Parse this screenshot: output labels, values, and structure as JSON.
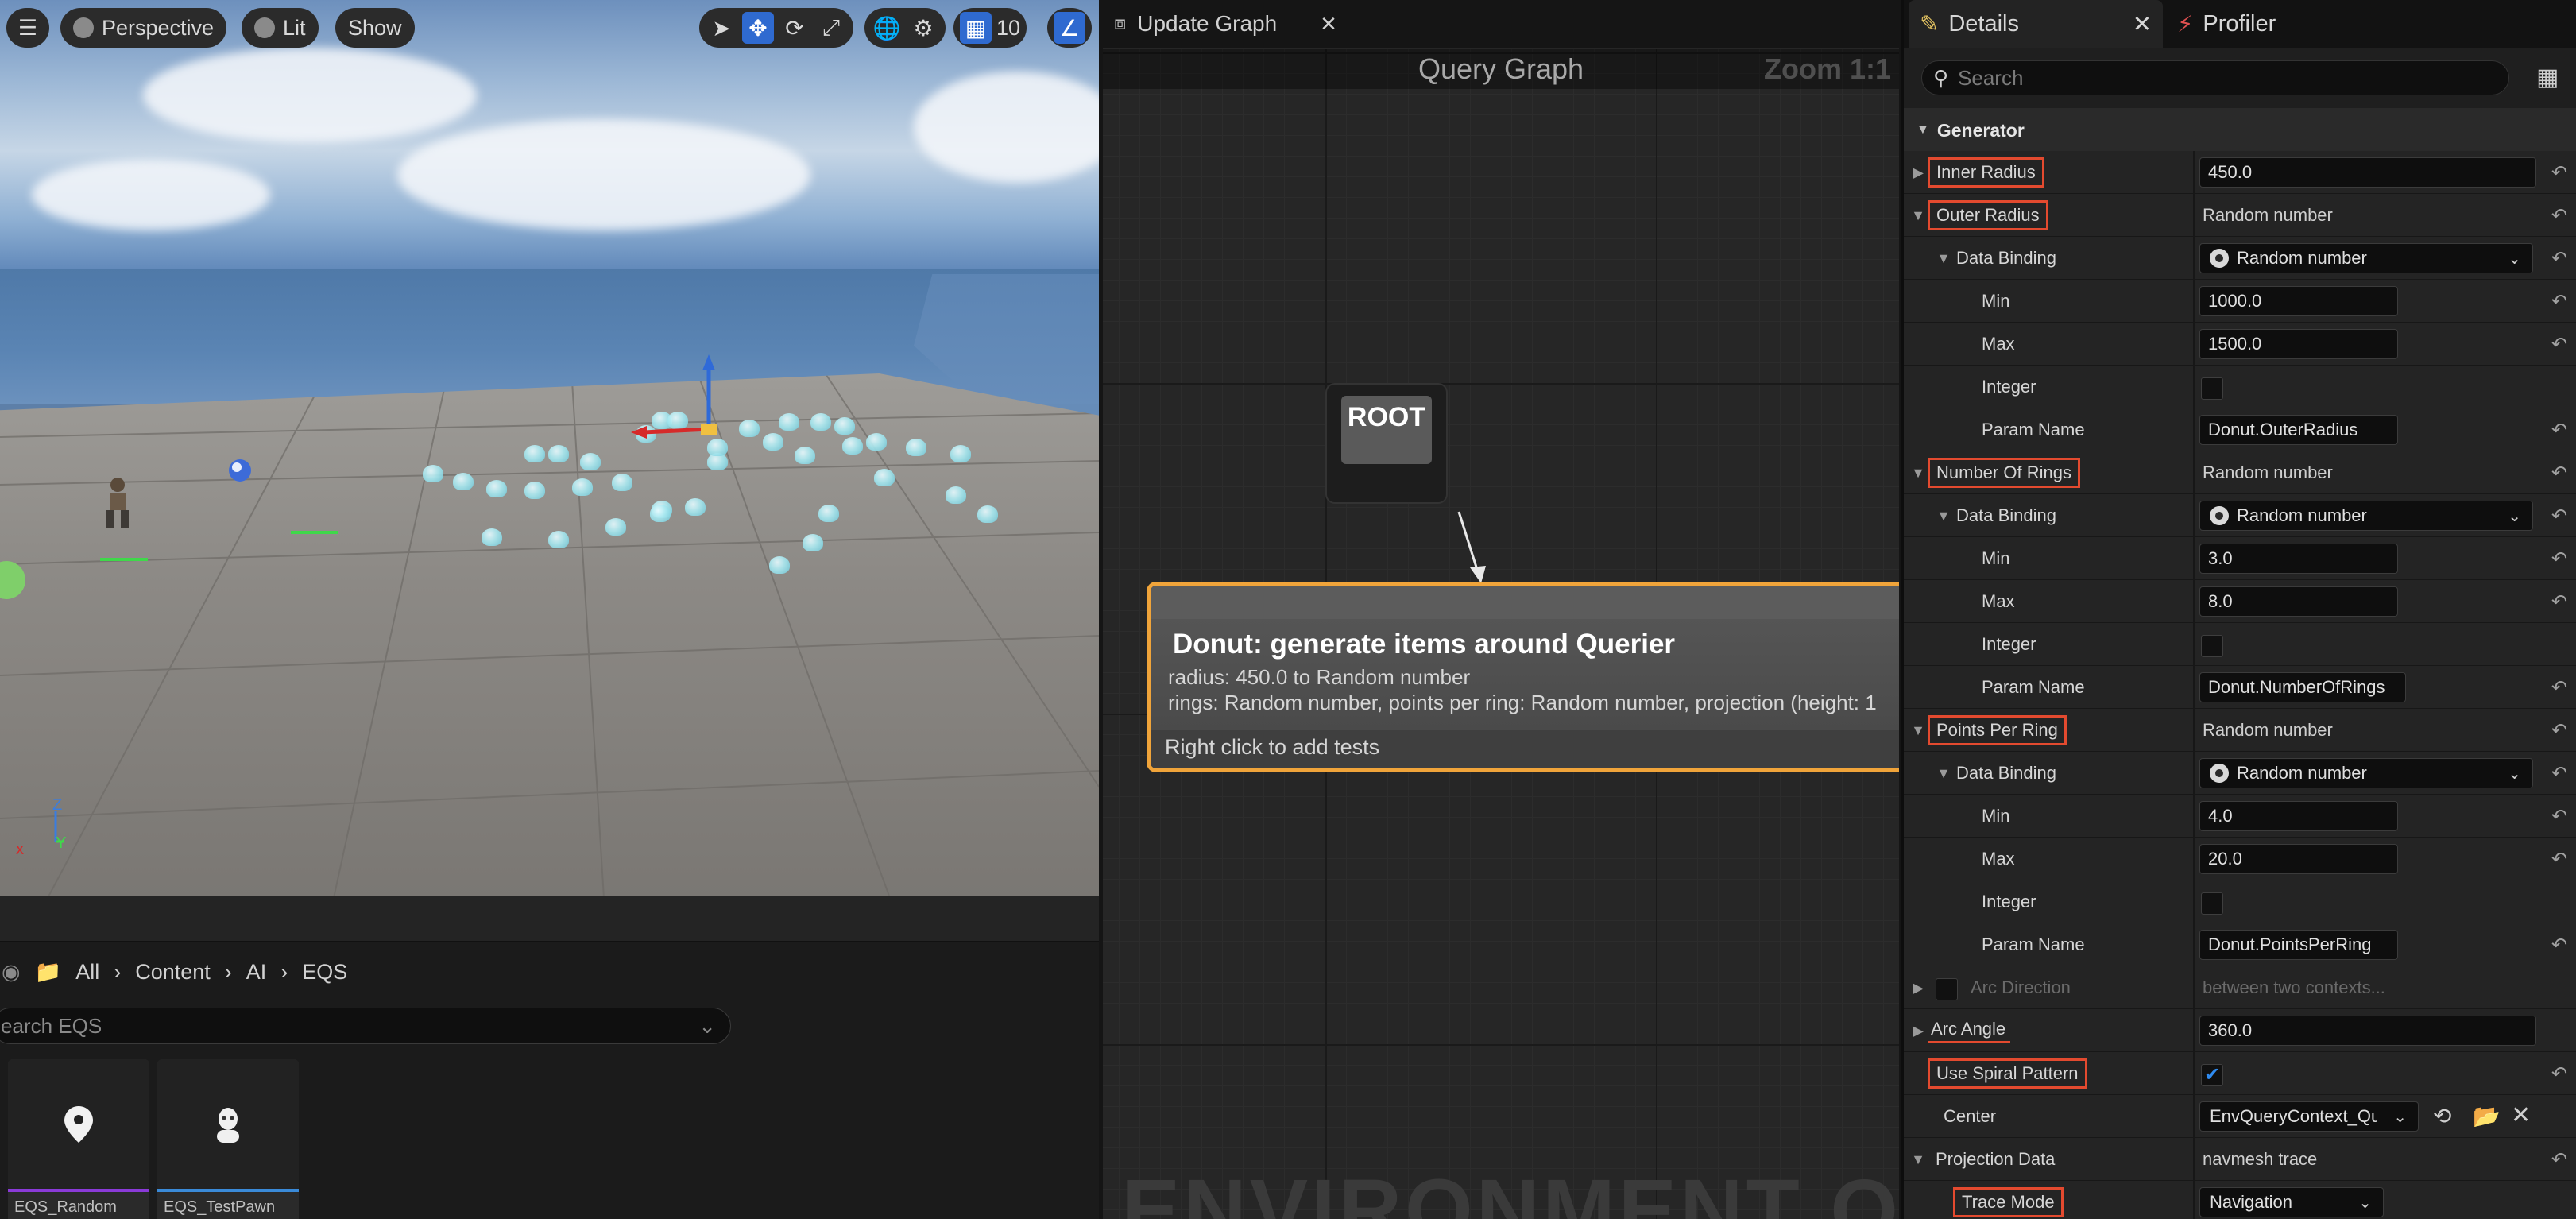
{
  "viewport": {
    "perspective_label": "Perspective",
    "lit_label": "Lit",
    "show_label": "Show",
    "grid_snap_value": "10"
  },
  "content_browser": {
    "breadcrumb": [
      "All",
      "Content",
      "AI",
      "EQS"
    ],
    "search_placeholder": "earch EQS",
    "assets": [
      {
        "name": "EQS_Random",
        "bar_color": "#8a3ad8"
      },
      {
        "name": "EQS_TestPawn",
        "bar_color": "#3a8ad8"
      }
    ]
  },
  "graph": {
    "tab_label": "Update Graph",
    "title": "Query Graph",
    "zoom": "Zoom 1:1",
    "root_label": "ROOT",
    "donut_title": "Donut: generate items around Querier",
    "donut_line1": "radius: 450.0 to Random number",
    "donut_line2": "rings: Random number, points per ring: Random number, projection (height: 1",
    "donut_hint": "Right click to add tests",
    "watermark": "ENVIRONMENT QU"
  },
  "details": {
    "tab_details": "Details",
    "tab_profiler": "Profiler",
    "search_placeholder": "Search",
    "section": "Generator",
    "rows": {
      "inner_radius": {
        "label": "Inner Radius",
        "value": "450.0"
      },
      "outer_radius": {
        "label": "Outer Radius",
        "value": "Random number"
      },
      "outer_binding": {
        "label": "Data Binding",
        "value": "Random number"
      },
      "outer_min": {
        "label": "Min",
        "value": "1000.0"
      },
      "outer_max": {
        "label": "Max",
        "value": "1500.0"
      },
      "outer_integer": {
        "label": "Integer"
      },
      "outer_param": {
        "label": "Param Name",
        "value": "Donut.OuterRadius"
      },
      "rings": {
        "label": "Number Of Rings",
        "value": "Random number"
      },
      "rings_binding": {
        "label": "Data Binding",
        "value": "Random number"
      },
      "rings_min": {
        "label": "Min",
        "value": "3.0"
      },
      "rings_max": {
        "label": "Max",
        "value": "8.0"
      },
      "rings_integer": {
        "label": "Integer"
      },
      "rings_param": {
        "label": "Param Name",
        "value": "Donut.NumberOfRings"
      },
      "ppr": {
        "label": "Points Per Ring",
        "value": "Random number"
      },
      "ppr_binding": {
        "label": "Data Binding",
        "value": "Random number"
      },
      "ppr_min": {
        "label": "Min",
        "value": "4.0"
      },
      "ppr_max": {
        "label": "Max",
        "value": "20.0"
      },
      "ppr_integer": {
        "label": "Integer"
      },
      "ppr_param": {
        "label": "Param Name",
        "value": "Donut.PointsPerRing"
      },
      "arc_direction": {
        "label": "Arc Direction",
        "value": "between two contexts..."
      },
      "arc_angle": {
        "label": "Arc Angle",
        "value": "360.0"
      },
      "spiral": {
        "label": "Use Spiral Pattern",
        "checked": true
      },
      "center": {
        "label": "Center",
        "value": "EnvQueryContext_Que"
      },
      "projection": {
        "label": "Projection Data",
        "value": "navmesh trace"
      },
      "trace_mode": {
        "label": "Trace Mode",
        "value": "Navigation"
      }
    },
    "highlight_color": "#e34a2f"
  }
}
